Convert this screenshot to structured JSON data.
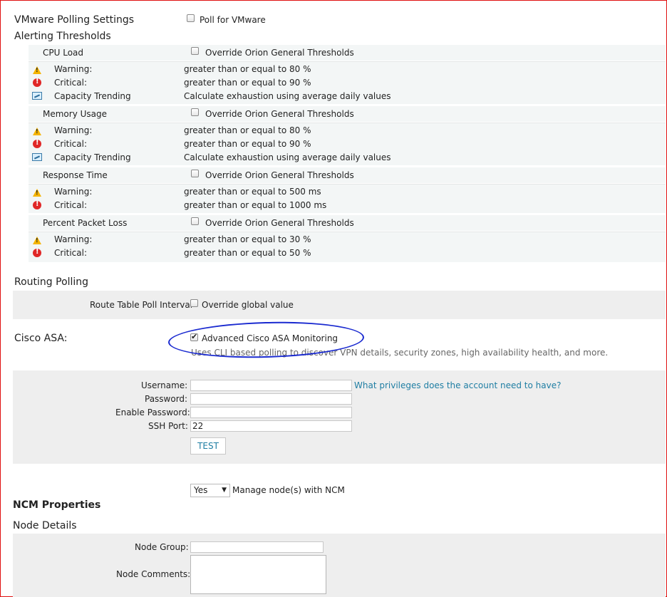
{
  "vmware": {
    "heading": "VMware Polling Settings",
    "poll_label": "Poll for VMware"
  },
  "alerting": {
    "heading": "Alerting Thresholds",
    "override_label": "Override Orion General Thresholds",
    "cpu": {
      "title": "CPU Load",
      "rows": [
        {
          "icon": "warning-icon",
          "label": "Warning:",
          "value": "greater than or equal to 80 %"
        },
        {
          "icon": "critical-icon",
          "label": "Critical:",
          "value": "greater than or equal to 90 %"
        },
        {
          "icon": "capacity-trending-icon",
          "label": "Capacity Trending",
          "value": "Calculate exhaustion using average daily values"
        }
      ]
    },
    "memory": {
      "title": "Memory Usage",
      "rows": [
        {
          "icon": "warning-icon",
          "label": "Warning:",
          "value": "greater than or equal to 80 %"
        },
        {
          "icon": "critical-icon",
          "label": "Critical:",
          "value": "greater than or equal to 90 %"
        },
        {
          "icon": "capacity-trending-icon",
          "label": "Capacity Trending",
          "value": "Calculate exhaustion using average daily values"
        }
      ]
    },
    "response": {
      "title": "Response Time",
      "rows": [
        {
          "icon": "warning-icon",
          "label": "Warning:",
          "value": "greater than or equal to 500 ms"
        },
        {
          "icon": "critical-icon",
          "label": "Critical:",
          "value": "greater than or equal to 1000 ms"
        }
      ]
    },
    "packet": {
      "title": "Percent Packet Loss",
      "rows": [
        {
          "icon": "warning-icon",
          "label": "Warning:",
          "value": "greater than or equal to 30 %"
        },
        {
          "icon": "critical-icon",
          "label": "Critical:",
          "value": "greater than or equal to 50 %"
        }
      ]
    }
  },
  "routing": {
    "heading": "Routing Polling",
    "interval_label": "Route Table Poll Interval",
    "override_label": "Override global value"
  },
  "cisco": {
    "heading": "Cisco ASA:",
    "monitoring_label": "Advanced Cisco ASA Monitoring",
    "monitoring_checked": true,
    "description": "Uses CLI based polling to discover VPN details, security zones, high availability health, and more.",
    "username_label": "Username:",
    "password_label": "Password:",
    "enable_password_label": "Enable Password:",
    "ssh_port_label": "SSH Port:",
    "ssh_port_value": "22",
    "privileges_link": "What privileges does the account need to have?",
    "test_button": "TEST"
  },
  "ncm": {
    "manage_value": "Yes",
    "manage_label": "Manage node(s) with NCM",
    "heading": "NCM Properties"
  },
  "node_details": {
    "heading": "Node Details",
    "group_label": "Node Group:",
    "comments_label": "Node Comments:"
  },
  "colors": {
    "link": "#1f7ea3",
    "annotation": "#1a2ad0",
    "frame": "#e01010"
  }
}
